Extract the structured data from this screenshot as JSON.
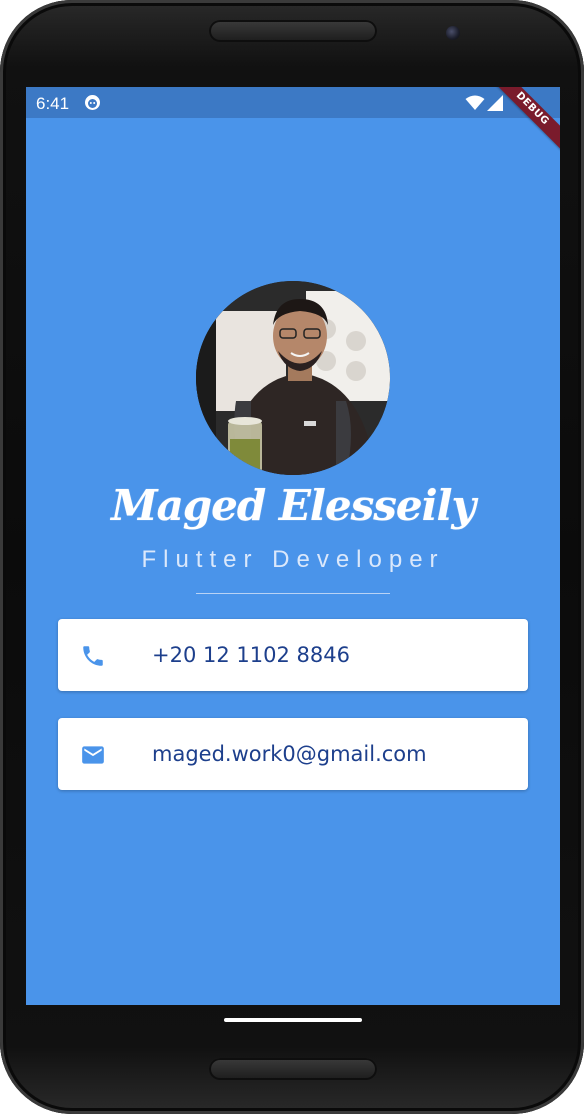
{
  "status_bar": {
    "time": "6:41",
    "app_icon": "app-notification-icon",
    "wifi_icon": "wifi-icon",
    "signal_icon": "signal-icon",
    "background_color": "#3c79c5"
  },
  "debug_banner": {
    "label": "DEBUG",
    "color": "#7a1b2c"
  },
  "profile": {
    "avatar": "profile-photo",
    "name": "Maged Elesseily",
    "title": "Flutter Developer"
  },
  "contacts": [
    {
      "icon": "phone-icon",
      "value": "+20 12 1102 8846"
    },
    {
      "icon": "email-icon",
      "value": "maged.work0@gmail.com"
    }
  ],
  "colors": {
    "background": "#4a94ea",
    "card": "#ffffff",
    "card_text": "#1d3f8c",
    "icon": "#4a94ea"
  }
}
